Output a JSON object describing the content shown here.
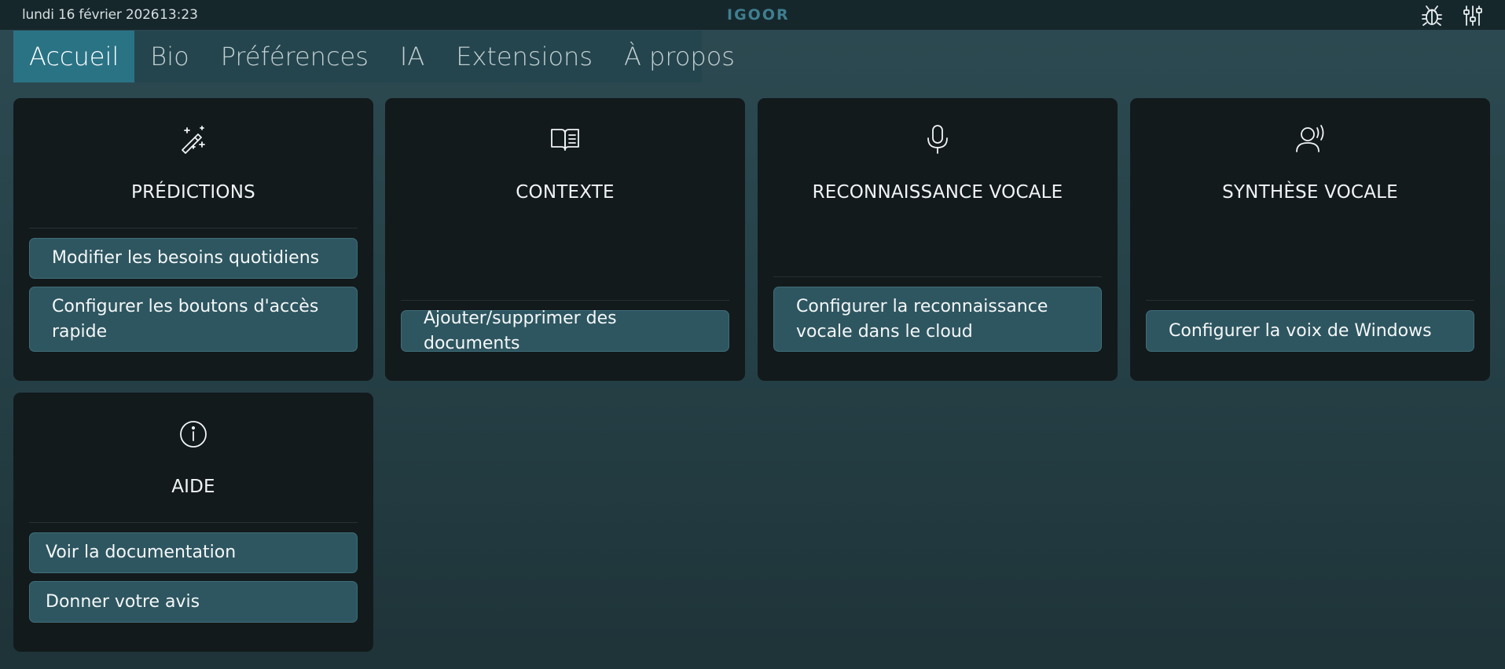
{
  "status_bar": {
    "date": "lundi 16 février 2026",
    "time": "13:23",
    "logo": "IGOOR",
    "bug_icon": "bug-icon",
    "settings_icon": "sliders-icon"
  },
  "tabs": [
    {
      "label": "Accueil",
      "active": true
    },
    {
      "label": "Bio"
    },
    {
      "label": "Préférences"
    },
    {
      "label": "IA"
    },
    {
      "label": "Extensions"
    },
    {
      "label": "À propos"
    }
  ],
  "cards": {
    "predictions": {
      "icon": "magic-wand-icon",
      "title": "PRÉDICTIONS",
      "buttons": [
        "Modifier les besoins quotidiens",
        "Configurer les boutons d'accès rapide"
      ]
    },
    "context": {
      "icon": "book-icon",
      "title": "CONTEXTE",
      "buttons": [
        "Ajouter/supprimer des documents"
      ]
    },
    "speech_recognition": {
      "icon": "microphone-icon",
      "title": "RECONNAISSANCE VOCALE",
      "buttons": [
        "Configurer la reconnaissance vocale dans le cloud"
      ]
    },
    "speech_synthesis": {
      "icon": "speaking-user-icon",
      "title": "SYNTHÈSE VOCALE",
      "buttons": [
        "Configurer la voix de Windows"
      ]
    },
    "help": {
      "icon": "info-icon",
      "title": "AIDE",
      "buttons": [
        "Voir la documentation",
        "Donner votre avis"
      ]
    }
  },
  "colors": {
    "accent": "#2a7385",
    "card_bg": "#131a1c",
    "button_bg": "#2e5660",
    "logo": "#3f7f90"
  }
}
